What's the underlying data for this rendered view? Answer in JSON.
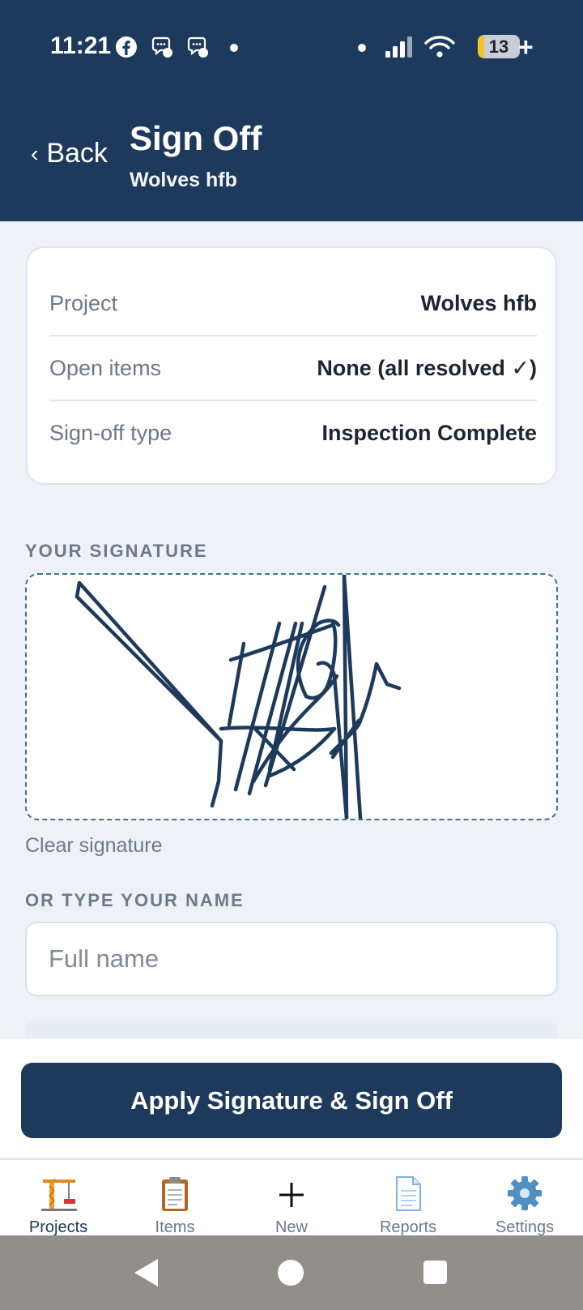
{
  "status_bar": {
    "time": "11:21",
    "battery_level": "13",
    "icons": [
      "facebook-icon",
      "messenger-icon",
      "messenger-icon",
      "dot-icon",
      "dot-icon",
      "signal-icon",
      "wifi-icon",
      "battery-icon"
    ]
  },
  "header": {
    "back_label": "Back",
    "title": "Sign Off",
    "subtitle": "Wolves hfb"
  },
  "summary": {
    "rows": [
      {
        "label": "Project",
        "value": "Wolves hfb"
      },
      {
        "label": "Open items",
        "value": "None (all resolved ✓)"
      },
      {
        "label": "Sign-off type",
        "value": "Inspection Complete"
      }
    ]
  },
  "signature": {
    "section_label": "YOUR SIGNATURE",
    "clear_label": "Clear signature",
    "ink_color": "#1d3a5c"
  },
  "name_entry": {
    "section_label": "OR TYPE YOUR NAME",
    "placeholder": "Full name",
    "value": ""
  },
  "action": {
    "primary_label": "Apply Signature & Sign Off"
  },
  "tabs": [
    {
      "label": "Projects",
      "icon": "crane-icon",
      "active": true
    },
    {
      "label": "Items",
      "icon": "clipboard-icon",
      "active": false
    },
    {
      "label": "New",
      "icon": "plus-icon",
      "active": false
    },
    {
      "label": "Reports",
      "icon": "document-icon",
      "active": false
    },
    {
      "label": "Settings",
      "icon": "gear-icon",
      "active": false
    }
  ],
  "colors": {
    "brand": "#1d3a5c",
    "background": "#eef2f7",
    "muted_text": "#6b7a8c"
  }
}
